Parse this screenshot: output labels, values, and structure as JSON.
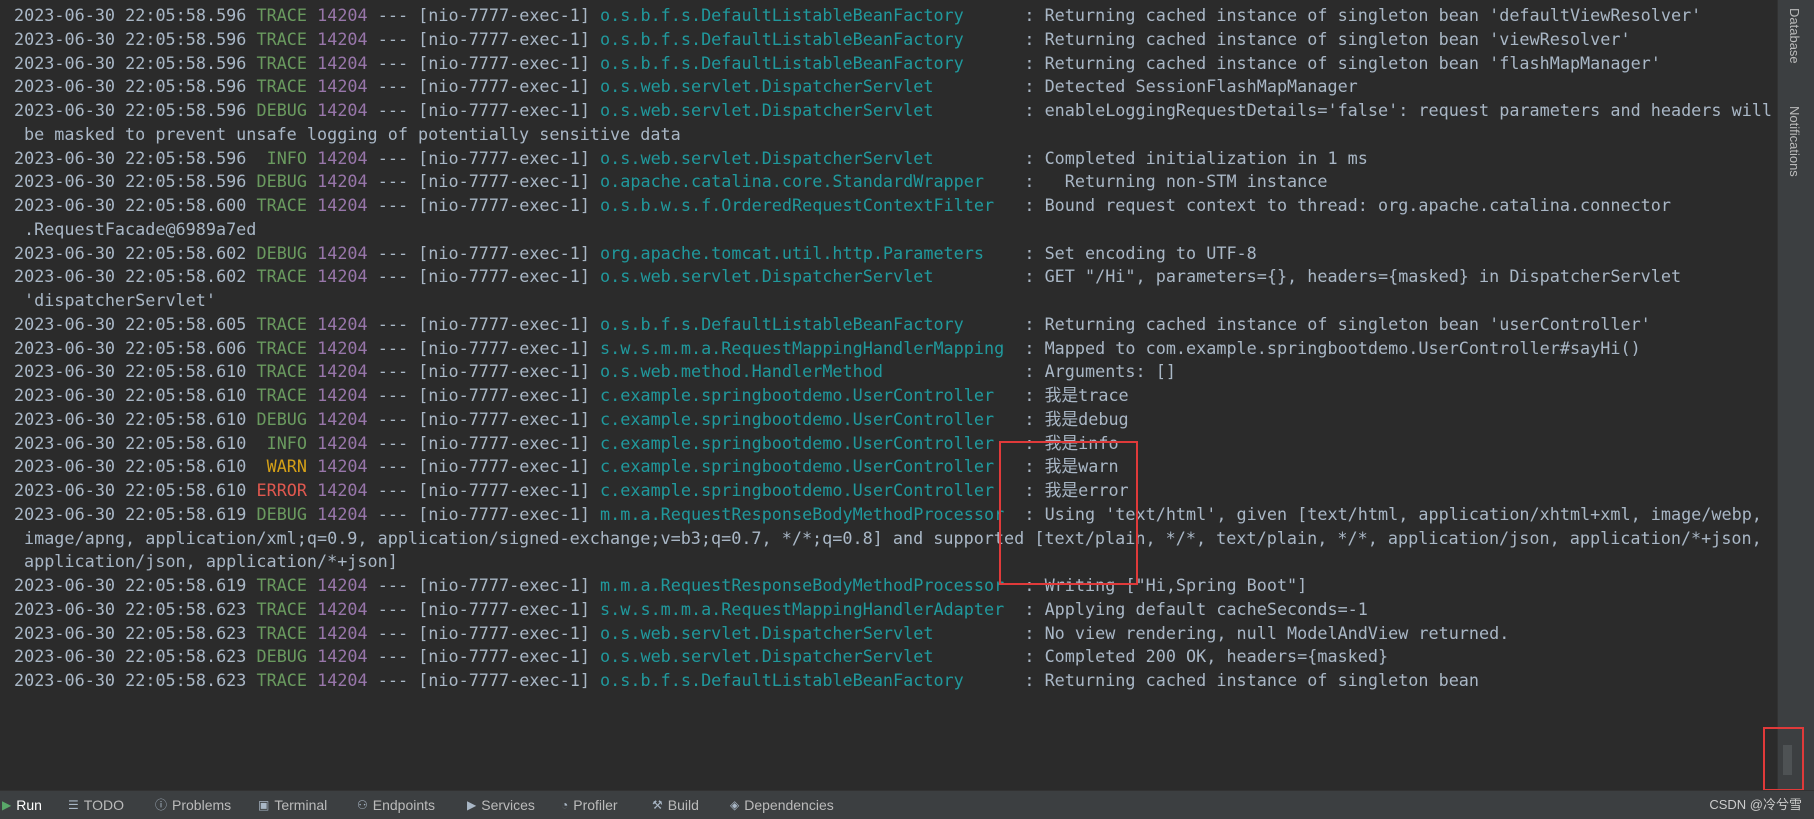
{
  "log": {
    "lines": [
      {
        "ts": "2023-06-30 22:05:58.596",
        "level": "TRACE",
        "pid": "14204",
        "thread": "--- [nio-7777-exec-1]",
        "logger": "o.s.b.f.s.DefaultListableBeanFactory",
        "msg": ": Returning cached instance of singleton bean 'defaultViewResolver'"
      },
      {
        "ts": "2023-06-30 22:05:58.596",
        "level": "TRACE",
        "pid": "14204",
        "thread": "--- [nio-7777-exec-1]",
        "logger": "o.s.b.f.s.DefaultListableBeanFactory",
        "msg": ": Returning cached instance of singleton bean 'viewResolver'"
      },
      {
        "ts": "2023-06-30 22:05:58.596",
        "level": "TRACE",
        "pid": "14204",
        "thread": "--- [nio-7777-exec-1]",
        "logger": "o.s.b.f.s.DefaultListableBeanFactory",
        "msg": ": Returning cached instance of singleton bean 'flashMapManager'"
      },
      {
        "ts": "2023-06-30 22:05:58.596",
        "level": "TRACE",
        "pid": "14204",
        "thread": "--- [nio-7777-exec-1]",
        "logger": "o.s.web.servlet.DispatcherServlet",
        "msg": ": Detected SessionFlashMapManager"
      },
      {
        "ts": "2023-06-30 22:05:58.596",
        "level": "DEBUG",
        "pid": "14204",
        "thread": "--- [nio-7777-exec-1]",
        "logger": "o.s.web.servlet.DispatcherServlet",
        "msg": ": enableLoggingRequestDetails='false': request parameters and headers will"
      },
      {
        "cont": "be masked to prevent unsafe logging of potentially sensitive data"
      },
      {
        "ts": "2023-06-30 22:05:58.596",
        "level": " INFO",
        "pid": "14204",
        "thread": "--- [nio-7777-exec-1]",
        "logger": "o.s.web.servlet.DispatcherServlet",
        "msg": ": Completed initialization in 1 ms"
      },
      {
        "ts": "2023-06-30 22:05:58.596",
        "level": "DEBUG",
        "pid": "14204",
        "thread": "--- [nio-7777-exec-1]",
        "logger": "o.apache.catalina.core.StandardWrapper",
        "msg": ":   Returning non-STM instance"
      },
      {
        "ts": "2023-06-30 22:05:58.600",
        "level": "TRACE",
        "pid": "14204",
        "thread": "--- [nio-7777-exec-1]",
        "logger": "o.s.b.w.s.f.OrderedRequestContextFilter",
        "msg": ": Bound request context to thread: org.apache.catalina.connector"
      },
      {
        "cont": ".RequestFacade@6989a7ed"
      },
      {
        "ts": "2023-06-30 22:05:58.602",
        "level": "DEBUG",
        "pid": "14204",
        "thread": "--- [nio-7777-exec-1]",
        "logger": "org.apache.tomcat.util.http.Parameters",
        "msg": ": Set encoding to UTF-8"
      },
      {
        "ts": "2023-06-30 22:05:58.602",
        "level": "TRACE",
        "pid": "14204",
        "thread": "--- [nio-7777-exec-1]",
        "logger": "o.s.web.servlet.DispatcherServlet",
        "msg": ": GET \"/Hi\", parameters={}, headers={masked} in DispatcherServlet"
      },
      {
        "cont": "'dispatcherServlet'"
      },
      {
        "ts": "2023-06-30 22:05:58.605",
        "level": "TRACE",
        "pid": "14204",
        "thread": "--- [nio-7777-exec-1]",
        "logger": "o.s.b.f.s.DefaultListableBeanFactory",
        "msg": ": Returning cached instance of singleton bean 'userController'"
      },
      {
        "ts": "2023-06-30 22:05:58.606",
        "level": "TRACE",
        "pid": "14204",
        "thread": "--- [nio-7777-exec-1]",
        "logger": "s.w.s.m.m.a.RequestMappingHandlerMapping",
        "msg": ": Mapped to com.example.springbootdemo.UserController#sayHi()"
      },
      {
        "ts": "2023-06-30 22:05:58.610",
        "level": "TRACE",
        "pid": "14204",
        "thread": "--- [nio-7777-exec-1]",
        "logger": "o.s.web.method.HandlerMethod",
        "msg": ": Arguments: []"
      },
      {
        "ts": "2023-06-30 22:05:58.610",
        "level": "TRACE",
        "pid": "14204",
        "thread": "--- [nio-7777-exec-1]",
        "logger": "c.example.springbootdemo.UserController",
        "msg": ": 我是trace"
      },
      {
        "ts": "2023-06-30 22:05:58.610",
        "level": "DEBUG",
        "pid": "14204",
        "thread": "--- [nio-7777-exec-1]",
        "logger": "c.example.springbootdemo.UserController",
        "msg": ": 我是debug"
      },
      {
        "ts": "2023-06-30 22:05:58.610",
        "level": " INFO",
        "pid": "14204",
        "thread": "--- [nio-7777-exec-1]",
        "logger": "c.example.springbootdemo.UserController",
        "msg": ": 我是info"
      },
      {
        "ts": "2023-06-30 22:05:58.610",
        "level": " WARN",
        "pid": "14204",
        "thread": "--- [nio-7777-exec-1]",
        "logger": "c.example.springbootdemo.UserController",
        "msg": ": 我是warn"
      },
      {
        "ts": "2023-06-30 22:05:58.610",
        "level": "ERROR",
        "pid": "14204",
        "thread": "--- [nio-7777-exec-1]",
        "logger": "c.example.springbootdemo.UserController",
        "msg": ": 我是error"
      },
      {
        "ts": "2023-06-30 22:05:58.619",
        "level": "DEBUG",
        "pid": "14204",
        "thread": "--- [nio-7777-exec-1]",
        "logger": "m.m.a.RequestResponseBodyMethodProcessor",
        "msg": ": Using 'text/html', given [text/html, application/xhtml+xml, image/webp,"
      },
      {
        "cont": "image/apng, application/xml;q=0.9, application/signed-exchange;v=b3;q=0.7, */*;q=0.8] and supported [text/plain, */*, text/plain, */*, application/json, application/*+json,"
      },
      {
        "cont": "application/json, application/*+json]"
      },
      {
        "ts": "2023-06-30 22:05:58.619",
        "level": "TRACE",
        "pid": "14204",
        "thread": "--- [nio-7777-exec-1]",
        "logger": "m.m.a.RequestResponseBodyMethodProcessor",
        "msg": ": Writing [\"Hi,Spring Boot\"]"
      },
      {
        "ts": "2023-06-30 22:05:58.623",
        "level": "TRACE",
        "pid": "14204",
        "thread": "--- [nio-7777-exec-1]",
        "logger": "s.w.s.m.m.a.RequestMappingHandlerAdapter",
        "msg": ": Applying default cacheSeconds=-1"
      },
      {
        "ts": "2023-06-30 22:05:58.623",
        "level": "TRACE",
        "pid": "14204",
        "thread": "--- [nio-7777-exec-1]",
        "logger": "o.s.web.servlet.DispatcherServlet",
        "msg": ": No view rendering, null ModelAndView returned."
      },
      {
        "ts": "2023-06-30 22:05:58.623",
        "level": "DEBUG",
        "pid": "14204",
        "thread": "--- [nio-7777-exec-1]",
        "logger": "o.s.web.servlet.DispatcherServlet",
        "msg": ": Completed 200 OK, headers={masked}"
      },
      {
        "ts": "2023-06-30 22:05:58.623",
        "level": "TRACE",
        "pid": "14204",
        "thread": "--- [nio-7777-exec-1]",
        "logger": "o.s.b.f.s.DefaultListableBeanFactory",
        "msg": ": Returning cached instance of singleton bean"
      }
    ]
  },
  "side_tabs": {
    "database": "Database",
    "notifications": "Notifications"
  },
  "bottom_bar": {
    "tabs": [
      {
        "label": "Run",
        "icon": "run-icon",
        "active": true
      },
      {
        "label": "TODO",
        "icon": "list-icon"
      },
      {
        "label": "Problems",
        "icon": "info-icon"
      },
      {
        "label": "Terminal",
        "icon": "terminal-icon"
      },
      {
        "label": "Endpoints",
        "icon": "endpoints-icon"
      },
      {
        "label": "Services",
        "icon": "services-icon"
      },
      {
        "label": "Profiler",
        "icon": "profiler-icon"
      },
      {
        "label": "Build",
        "icon": "hammer-icon"
      },
      {
        "label": "Dependencies",
        "icon": "dependencies-icon"
      }
    ],
    "watermark": "CSDN @冷兮雪"
  },
  "colors": {
    "background": "#2b2b2b",
    "text": "#a9b7c6",
    "level_default": "#6a9a5f",
    "level_warn": "#d4a017",
    "level_error": "#e0584f",
    "pid": "#9876aa",
    "logger": "#20999d",
    "highlight": "#e03a3a"
  }
}
